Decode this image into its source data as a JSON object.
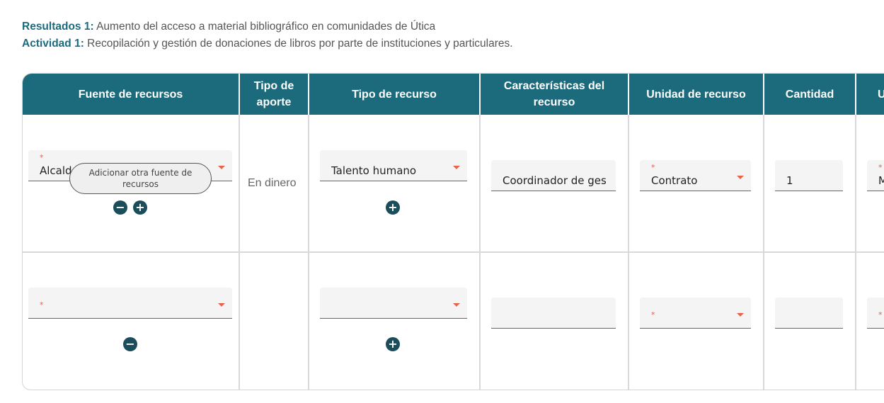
{
  "info": {
    "result_label": "Resultados 1:",
    "result_text": "Aumento del acceso a material bibliográfico en comunidades de Útica",
    "activity_label": "Actividad 1:",
    "activity_text": "Recopilación y gestión de donaciones de libros por parte de instituciones y particulares."
  },
  "table": {
    "headers": [
      "Fuente de recursos",
      "Tipo de aporte",
      "Tipo de recurso",
      "Características del recurso",
      "Unidad de recurso",
      "Cantidad",
      "U"
    ],
    "rows": [
      {
        "fuente": "Alcald",
        "tipo_aporte": "En dinero",
        "tipo_recurso": "Talento humano",
        "caracteristicas": "Coordinador de ges",
        "unidad": "Contrato",
        "cantidad": "1",
        "extra": "M"
      },
      {
        "fuente": "",
        "tipo_aporte": "",
        "tipo_recurso": "",
        "caracteristicas": "",
        "unidad": "",
        "cantidad": "",
        "extra": ""
      }
    ],
    "required_mark": "*",
    "tooltip": "Adicionar otra fuente de recursos"
  },
  "icons": {
    "remove": "minus-circle-icon",
    "add": "plus-circle-icon",
    "dropdown": "caret-down-icon"
  },
  "colors": {
    "header_bg": "#1c6b7d",
    "accent": "#e5644b",
    "icon_bg": "#1c4d5a"
  }
}
